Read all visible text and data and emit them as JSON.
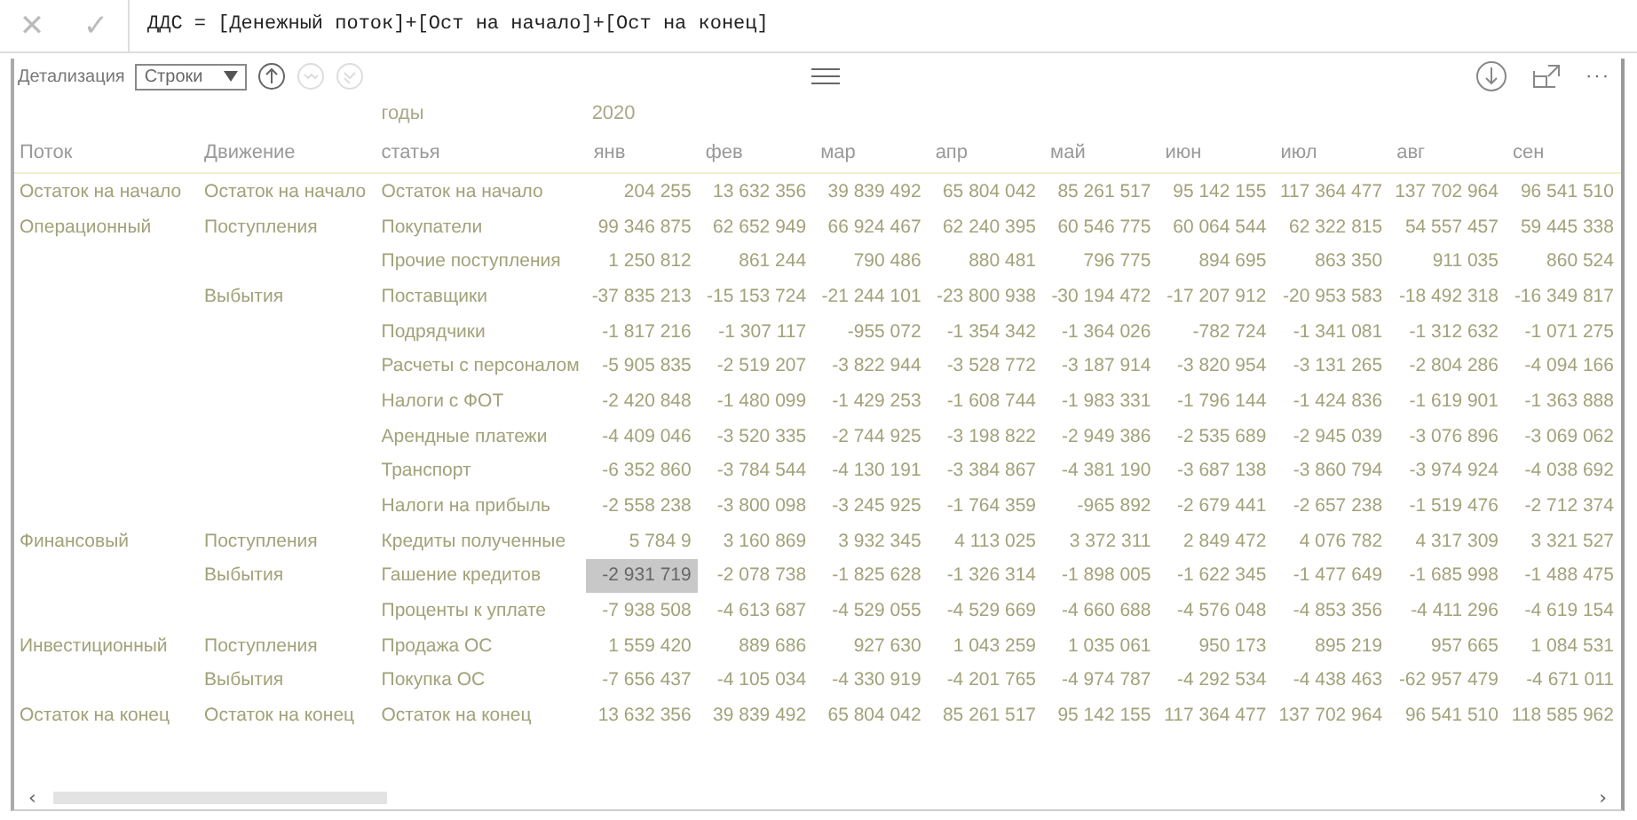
{
  "formula_bar": {
    "cancel": "✕",
    "confirm": "✓",
    "formula": "ДДС = [Денежный поток]+[Ост на начало]+[Ост на конец]"
  },
  "toolbar": {
    "label": "Детализация",
    "select_value": "Строки",
    "buttons": [
      {
        "kind": "up",
        "disabled": false
      },
      {
        "kind": "down",
        "disabled": true
      },
      {
        "kind": "expand",
        "disabled": true
      }
    ],
    "more": "···"
  },
  "table": {
    "header_top": {
      "label": "годы",
      "year": "2020"
    },
    "row_header_titles": [
      "Поток",
      "Движение",
      "статья"
    ],
    "columns": [
      "янв",
      "фев",
      "мар",
      "апр",
      "май",
      "июн",
      "июл",
      "авг",
      "сен"
    ],
    "rows": [
      {
        "flow": "Остаток на начало",
        "movement": "Остаток на начало",
        "item": "Остаток на начало",
        "cells": [
          {
            "text": "204 255",
            "selected": false
          },
          {
            "text": "13 632 356",
            "selected": false
          },
          {
            "text": "39 839 492",
            "selected": false
          },
          {
            "text": "65 804 042",
            "selected": false
          },
          {
            "text": "85 261 517",
            "selected": false
          },
          {
            "text": "95 142 155",
            "selected": false
          },
          {
            "text": "117 364 477",
            "selected": false
          },
          {
            "text": "137 702 964",
            "selected": false
          },
          {
            "text": "96 541 510",
            "selected": false
          }
        ]
      },
      {
        "flow": "Операционный",
        "movement": "Поступления",
        "item": "Покупатели",
        "cells": [
          {
            "text": "99 346 875",
            "selected": false
          },
          {
            "text": "62 652 949",
            "selected": false
          },
          {
            "text": "66 924 467",
            "selected": false
          },
          {
            "text": "62 240 395",
            "selected": false
          },
          {
            "text": "60 546 775",
            "selected": false
          },
          {
            "text": "60 064 544",
            "selected": false
          },
          {
            "text": "62 322 815",
            "selected": false
          },
          {
            "text": "54 557 457",
            "selected": false
          },
          {
            "text": "59 445 338",
            "selected": false
          }
        ]
      },
      {
        "item": "Прочие поступления",
        "cells": [
          {
            "text": "1 250 812",
            "selected": false
          },
          {
            "text": "861 244",
            "selected": false
          },
          {
            "text": "790 486",
            "selected": false
          },
          {
            "text": "880 481",
            "selected": false
          },
          {
            "text": "796 775",
            "selected": false
          },
          {
            "text": "894 695",
            "selected": false
          },
          {
            "text": "863 350",
            "selected": false
          },
          {
            "text": "911 035",
            "selected": false
          },
          {
            "text": "860 524",
            "selected": false
          }
        ]
      },
      {
        "movement": "Выбытия",
        "item": "Поставщики",
        "cells": [
          {
            "text": "-37 835 213",
            "selected": false
          },
          {
            "text": "-15 153 724",
            "selected": false
          },
          {
            "text": "-21 244 101",
            "selected": false
          },
          {
            "text": "-23 800 938",
            "selected": false
          },
          {
            "text": "-30 194 472",
            "selected": false
          },
          {
            "text": "-17 207 912",
            "selected": false
          },
          {
            "text": "-20 953 583",
            "selected": false
          },
          {
            "text": "-18 492 318",
            "selected": false
          },
          {
            "text": "-16 349 817",
            "selected": false
          }
        ]
      },
      {
        "item": "Подрядчики",
        "cells": [
          {
            "text": "-1 817 216",
            "selected": false
          },
          {
            "text": "-1 307 117",
            "selected": false
          },
          {
            "text": "-955 072",
            "selected": false
          },
          {
            "text": "-1 354 342",
            "selected": false
          },
          {
            "text": "-1 364 026",
            "selected": false
          },
          {
            "text": "-782 724",
            "selected": false
          },
          {
            "text": "-1 341 081",
            "selected": false
          },
          {
            "text": "-1 312 632",
            "selected": false
          },
          {
            "text": "-1 071 275",
            "selected": false
          }
        ]
      },
      {
        "item": "Расчеты с персоналом",
        "cells": [
          {
            "text": "-5 905 835",
            "selected": false
          },
          {
            "text": "-2 519 207",
            "selected": false
          },
          {
            "text": "-3 822 944",
            "selected": false
          },
          {
            "text": "-3 528 772",
            "selected": false
          },
          {
            "text": "-3 187 914",
            "selected": false
          },
          {
            "text": "-3 820 954",
            "selected": false
          },
          {
            "text": "-3 131 265",
            "selected": false
          },
          {
            "text": "-2 804 286",
            "selected": false
          },
          {
            "text": "-4 094 166",
            "selected": false
          }
        ]
      },
      {
        "item": "Налоги с ФОТ",
        "cells": [
          {
            "text": "-2 420 848",
            "selected": false
          },
          {
            "text": "-1 480 099",
            "selected": false
          },
          {
            "text": "-1 429 253",
            "selected": false
          },
          {
            "text": "-1 608 744",
            "selected": false
          },
          {
            "text": "-1 983 331",
            "selected": false
          },
          {
            "text": "-1 796 144",
            "selected": false
          },
          {
            "text": "-1 424 836",
            "selected": false
          },
          {
            "text": "-1 619 901",
            "selected": false
          },
          {
            "text": "-1 363 888",
            "selected": false
          }
        ]
      },
      {
        "item": "Арендные платежи",
        "cells": [
          {
            "text": "-4 409 046",
            "selected": false
          },
          {
            "text": "-3 520 335",
            "selected": false
          },
          {
            "text": "-2 744 925",
            "selected": false
          },
          {
            "text": "-3 198 822",
            "selected": false
          },
          {
            "text": "-2 949 386",
            "selected": false
          },
          {
            "text": "-2 535 689",
            "selected": false
          },
          {
            "text": "-2 945 039",
            "selected": false
          },
          {
            "text": "-3 076 896",
            "selected": false
          },
          {
            "text": "-3 069 062",
            "selected": false
          }
        ]
      },
      {
        "item": "Транспорт",
        "cells": [
          {
            "text": "-6 352 860",
            "selected": false
          },
          {
            "text": "-3 784 544",
            "selected": false
          },
          {
            "text": "-4 130 191",
            "selected": false
          },
          {
            "text": "-3 384 867",
            "selected": false
          },
          {
            "text": "-4 381 190",
            "selected": false
          },
          {
            "text": "-3 687 138",
            "selected": false
          },
          {
            "text": "-3 860 794",
            "selected": false
          },
          {
            "text": "-3 974 924",
            "selected": false
          },
          {
            "text": "-4 038 692",
            "selected": false
          }
        ]
      },
      {
        "item": "Налоги на прибыль",
        "cells": [
          {
            "text": "-2 558 238",
            "selected": false
          },
          {
            "text": "-3 800 098",
            "selected": false
          },
          {
            "text": "-3 245 925",
            "selected": false
          },
          {
            "text": "-1 764 359",
            "selected": false
          },
          {
            "text": "-965 892",
            "selected": false
          },
          {
            "text": "-2 679 441",
            "selected": false
          },
          {
            "text": "-2 657 238",
            "selected": false
          },
          {
            "text": "-1 519 476",
            "selected": false
          },
          {
            "text": "-2 712 374",
            "selected": false
          }
        ]
      },
      {
        "flow": "Финансовый",
        "movement": "Поступления",
        "item": "Кредиты полученные",
        "cells": [
          {
            "text": "5 784 9",
            "selected": false
          },
          {
            "text": "3 160 869",
            "selected": false
          },
          {
            "text": "3 932 345",
            "selected": false
          },
          {
            "text": "4 113 025",
            "selected": false
          },
          {
            "text": "3 372 311",
            "selected": false
          },
          {
            "text": "2 849 472",
            "selected": false
          },
          {
            "text": "4 076 782",
            "selected": false
          },
          {
            "text": "4 317 309",
            "selected": false
          },
          {
            "text": "3 321 527",
            "selected": false
          }
        ]
      },
      {
        "movement": "Выбытия",
        "item": "Гашение кредитов",
        "cells": [
          {
            "text": "-2 931 719",
            "selected": true
          },
          {
            "text": "-2 078 738",
            "selected": false
          },
          {
            "text": "-1 825 628",
            "selected": false
          },
          {
            "text": "-1 326 314",
            "selected": false
          },
          {
            "text": "-1 898 005",
            "selected": false
          },
          {
            "text": "-1 622 345",
            "selected": false
          },
          {
            "text": "-1 477 649",
            "selected": false
          },
          {
            "text": "-1 685 998",
            "selected": false
          },
          {
            "text": "-1 488 475",
            "selected": false
          }
        ]
      },
      {
        "item": "Проценты к уплате",
        "cells": [
          {
            "text": "-7 938 508",
            "selected": false
          },
          {
            "text": "-4 613 687",
            "selected": false
          },
          {
            "text": "-4 529 055",
            "selected": false
          },
          {
            "text": "-4 529 669",
            "selected": false
          },
          {
            "text": "-4 660 688",
            "selected": false
          },
          {
            "text": "-4 576 048",
            "selected": false
          },
          {
            "text": "-4 853 356",
            "selected": false
          },
          {
            "text": "-4 411 296",
            "selected": false
          },
          {
            "text": "-4 619 154",
            "selected": false
          }
        ]
      },
      {
        "flow": "Инвестиционный",
        "movement": "Поступления",
        "item": "Продажа ОС",
        "cells": [
          {
            "text": "1 559 420",
            "selected": false
          },
          {
            "text": "889 686",
            "selected": false
          },
          {
            "text": "927 630",
            "selected": false
          },
          {
            "text": "1 043 259",
            "selected": false
          },
          {
            "text": "1 035 061",
            "selected": false
          },
          {
            "text": "950 173",
            "selected": false
          },
          {
            "text": "895 219",
            "selected": false
          },
          {
            "text": "957 665",
            "selected": false
          },
          {
            "text": "1 084 531",
            "selected": false
          }
        ]
      },
      {
        "movement": "Выбытия",
        "item": "Покупка ОС",
        "cells": [
          {
            "text": "-7 656 437",
            "selected": false
          },
          {
            "text": "-4 105 034",
            "selected": false
          },
          {
            "text": "-4 330 919",
            "selected": false
          },
          {
            "text": "-4 201 765",
            "selected": false
          },
          {
            "text": "-4 974 787",
            "selected": false
          },
          {
            "text": "-4 292 534",
            "selected": false
          },
          {
            "text": "-4 438 463",
            "selected": false
          },
          {
            "text": "-62 957 479",
            "selected": false
          },
          {
            "text": "-4 671 011",
            "selected": false
          }
        ]
      },
      {
        "flow": "Остаток на конец",
        "movement": "Остаток на конец",
        "item": "Остаток на конец",
        "cells": [
          {
            "text": "13 632 356",
            "selected": false
          },
          {
            "text": "39 839 492",
            "selected": false
          },
          {
            "text": "65 804 042",
            "selected": false
          },
          {
            "text": "85 261 517",
            "selected": false
          },
          {
            "text": "95 142 155",
            "selected": false
          },
          {
            "text": "117 364 477",
            "selected": false
          },
          {
            "text": "137 702 964",
            "selected": false
          },
          {
            "text": "96 541 510",
            "selected": false
          },
          {
            "text": "118 585 962",
            "selected": false
          }
        ]
      }
    ]
  },
  "scrollbar": {
    "left": "‹",
    "right": "›"
  }
}
